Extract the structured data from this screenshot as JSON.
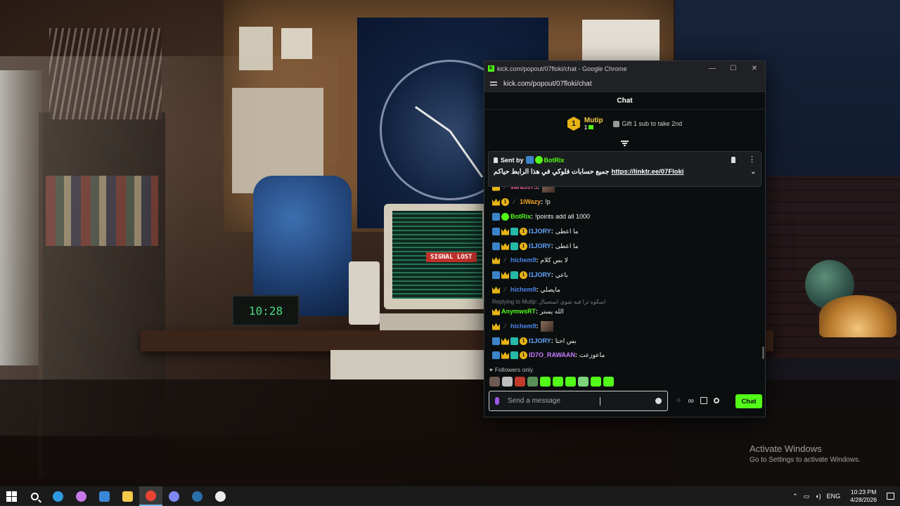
{
  "wallpaper": {
    "clock_text": "10:28",
    "signal_text": "SIGNAL LOST"
  },
  "activation": {
    "title": "Activate Windows",
    "subtitle": "Go to Settings to activate Windows."
  },
  "window": {
    "title": "kick.com/popout/07floki/chat - Google Chrome",
    "url": "kick.com/popout/07floki/chat",
    "minimize": "—",
    "maximize": "☐",
    "close": "✕"
  },
  "chat": {
    "header": "Chat",
    "leaderboard": {
      "rank": "1",
      "user": "Mutip",
      "count": "1",
      "gift_text": "Gift 1 sub to take 2nd"
    },
    "pinned": {
      "sent_by": "Sent by",
      "sender": "BotRix",
      "message": "جميع حسابات فلوكي في هذا الرابط حياكم",
      "link": "https://linktr.ee/07Floki"
    },
    "messages": [
      {
        "user": "sara3975",
        "color": "#e05a8b",
        "text": "",
        "emote": true,
        "badges": [
          "crown",
          "mute"
        ]
      },
      {
        "user": "1iWazy",
        "color": "#f5a623",
        "text": "!p",
        "badges": [
          "crown",
          "og",
          "mute"
        ]
      },
      {
        "user": "BotRix",
        "color": "#53fc18",
        "text": "!points add all 1000",
        "badges": [
          "mod",
          "verified"
        ]
      },
      {
        "user": "I1JORY",
        "color": "#61a8ff",
        "text": "ما اعطى",
        "badges": [
          "mod",
          "crown",
          "sub",
          "og"
        ]
      },
      {
        "user": "I1JORY",
        "color": "#61a8ff",
        "text": "ما اعطى",
        "badges": [
          "mod",
          "crown",
          "sub",
          "og"
        ]
      },
      {
        "user": "hichem9",
        "color": "#4c86e8",
        "text": "لا بس كلام",
        "badges": [
          "crown",
          "mute"
        ]
      },
      {
        "user": "I1JORY",
        "color": "#61a8ff",
        "text": "باعي",
        "badges": [
          "mod",
          "crown",
          "sub",
          "og"
        ]
      },
      {
        "user": "hichem9",
        "color": "#4c86e8",
        "text": "مايصلي",
        "badges": [
          "crown",
          "mute"
        ]
      },
      {
        "user": "AnymwsRT",
        "color": "#53fc18",
        "text": "الله يستر",
        "badges": [
          "crown"
        ]
      },
      {
        "user": "hichem9",
        "color": "#4c86e8",
        "text": "",
        "emote": true,
        "badges": [
          "crown",
          "mute"
        ]
      },
      {
        "user": "I1JORY",
        "color": "#61a8ff",
        "text": "بس احنا",
        "badges": [
          "mod",
          "crown",
          "sub",
          "og"
        ]
      },
      {
        "user": "ID7O_RAWAAN",
        "color": "#c77dff",
        "text": "ماعوزعت",
        "badges": [
          "mod",
          "crown",
          "sub",
          "og"
        ]
      }
    ],
    "reply_line": "Replying to Mutip: اسكوه ترا فيه شوي استعمال",
    "followers_only": "Followers only",
    "input_placeholder": "Send a message",
    "send_label": "Chat",
    "emote_colors": [
      "#6d5a52",
      "#bdbdbd",
      "#c0392b",
      "#5a8f5a",
      "#53fc18",
      "#53fc18",
      "#53fc18",
      "#7dd37d",
      "#53fc18",
      "#53fc18"
    ]
  },
  "taskbar": {
    "time": "10:23 PM",
    "date": "4/28/2026",
    "lang": "ENG",
    "apps": [
      {
        "name": "start",
        "color": "#ffffff"
      },
      {
        "name": "search",
        "color": "#ffffff"
      },
      {
        "name": "edge",
        "color": "#2f9be0"
      },
      {
        "name": "copilot",
        "color": "#c879e8"
      },
      {
        "name": "store",
        "color": "#3a86d9"
      },
      {
        "name": "explorer",
        "color": "#f2c94c"
      },
      {
        "name": "chrome",
        "color": "#e94335",
        "active": true
      },
      {
        "name": "discord",
        "color": "#7e88f5"
      },
      {
        "name": "steam",
        "color": "#2a6fa8"
      },
      {
        "name": "obs",
        "color": "#ececec"
      }
    ]
  }
}
